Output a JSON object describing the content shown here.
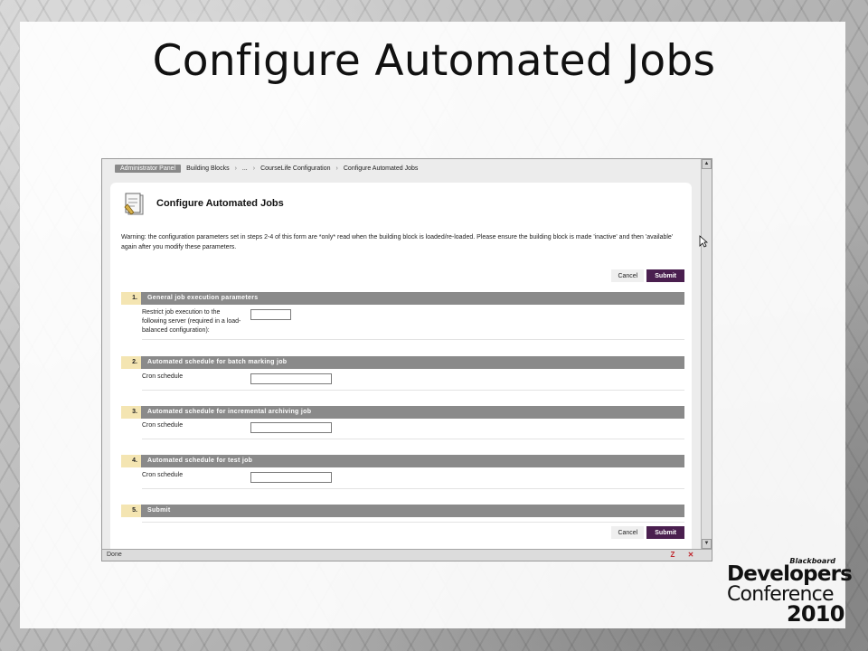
{
  "slide": {
    "title": "Configure Automated Jobs"
  },
  "breadcrumb": {
    "items": [
      "Administrator Panel",
      "Building Blocks",
      "...",
      "CourseLife Configuration",
      "Configure Automated Jobs"
    ],
    "separator": "›"
  },
  "page": {
    "title": "Configure Automated Jobs",
    "warning": "Warning: the configuration parameters set in steps 2-4 of this form are *only* read when the building block is loaded/re-loaded. Please ensure the building block is made 'inactive' and then 'available' again after you modify these parameters."
  },
  "buttons": {
    "cancel": "Cancel",
    "submit": "Submit"
  },
  "steps": [
    {
      "num": "1.",
      "title": "General job execution parameters",
      "field_label": "Restrict job execution to the following server (required in a load-balanced configuration):",
      "value": ""
    },
    {
      "num": "2.",
      "title": "Automated schedule for batch marking job",
      "field_label": "Cron schedule",
      "value": ""
    },
    {
      "num": "3.",
      "title": "Automated schedule for incremental archiving job",
      "field_label": "Cron schedule",
      "value": ""
    },
    {
      "num": "4.",
      "title": "Automated schedule for test job",
      "field_label": "Cron schedule",
      "value": ""
    },
    {
      "num": "5.",
      "title": "Submit"
    }
  ],
  "status_bar": {
    "text": "Done"
  },
  "logo": {
    "brand": "Blackboard",
    "line1": "Developers",
    "line2": "Conference",
    "line3": "2010"
  },
  "icons": [
    "page-edit-icon",
    "scroll-up-icon",
    "scroll-down-icon",
    "cursor-icon",
    "zotero-icon",
    "close-icon"
  ],
  "colors": {
    "submit": "#4a1f4f",
    "step_number_bg": "#f4e5b2",
    "step_bar_bg": "#8a8a8a"
  }
}
